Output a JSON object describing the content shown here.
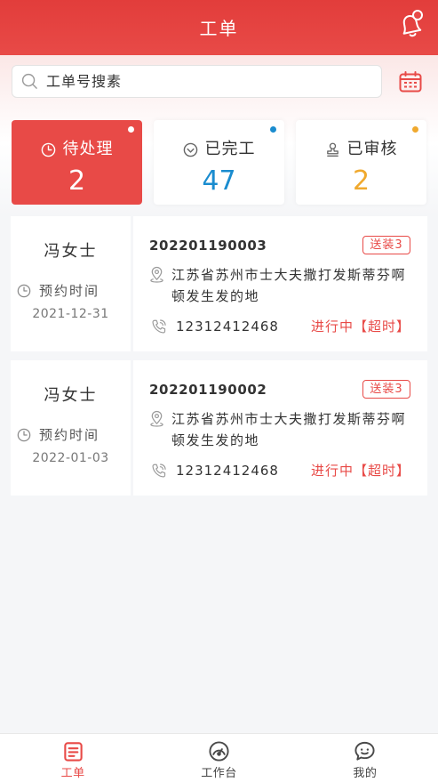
{
  "header": {
    "title": "工单",
    "icon": "bell-icon"
  },
  "search": {
    "placeholder": "工单号搜素",
    "icon": "search-icon",
    "calendar_icon": "calendar-icon"
  },
  "stats": [
    {
      "label": "待处理",
      "count": "2",
      "icon": "clock-icon",
      "active": true,
      "count_color": "#ffffff",
      "dot_color": "#ffffff"
    },
    {
      "label": "已完工",
      "count": "47",
      "icon": "check-circle-icon",
      "active": false,
      "count_color": "#1a8ccf",
      "dot_color": "#1a8ccf"
    },
    {
      "label": "已审核",
      "count": "2",
      "icon": "stamp-icon",
      "active": false,
      "count_color": "#f0a92e",
      "dot_color": "#f0a92e"
    }
  ],
  "order_icons": {
    "appointment": "clock-icon",
    "address": "location-pin-icon",
    "phone": "phone-icon"
  },
  "orders": [
    {
      "customer": "冯女士",
      "appointment_label": "预约时间",
      "appointment_date": "2021-12-31",
      "order_no": "202201190003",
      "badge": "送装3",
      "address": "江苏省苏州市士大夫撒打发斯蒂芬啊顿发生发的地",
      "phone": "12312412468",
      "status": "进行中【超时】"
    },
    {
      "customer": "冯女士",
      "appointment_label": "预约时间",
      "appointment_date": "2022-01-03",
      "order_no": "202201190002",
      "badge": "送装3",
      "address": "江苏省苏州市士大夫撒打发斯蒂芬啊顿发生发的地",
      "phone": "12312412468",
      "status": "进行中【超时】"
    }
  ],
  "tabbar": [
    {
      "label": "工单",
      "icon": "order-list-icon",
      "active": true
    },
    {
      "label": "工作台",
      "icon": "dashboard-gauge-icon",
      "active": false
    },
    {
      "label": "我的",
      "icon": "chat-face-icon",
      "active": false
    }
  ],
  "colors": {
    "primary": "#e84a47",
    "blue": "#1a8ccf",
    "orange": "#f0a92e",
    "text": "#333333",
    "background": "#f5f6f8"
  }
}
